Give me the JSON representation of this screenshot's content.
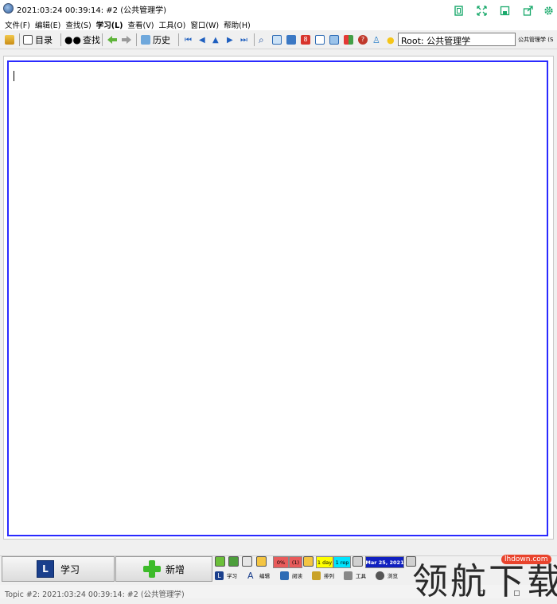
{
  "window": {
    "title": "2021:03:24 00:39:14: #2 (公共管理学)"
  },
  "menu": [
    "文件(F)",
    "编辑(E)",
    "查找(S)",
    "学习(L)",
    "查看(V)",
    "工具(O)",
    "窗口(W)",
    "帮助(H)"
  ],
  "toolbar": {
    "contents_label": "目录",
    "find_label": "查找",
    "history_label": "历史",
    "root_path": "Root: 公共管理学",
    "root_short": "公共管理学 (S"
  },
  "bottom": {
    "learn_label": "学习",
    "learn_badge": "L",
    "add_label": "新增",
    "stat_percent": "0%",
    "stat_count": "(1)",
    "stat_day": "1 day",
    "stat_rep": "1 rep",
    "stat_date": "Mar 25, 2021",
    "tools": [
      "学习",
      "编辑",
      "阅读",
      "排列",
      "工具",
      "浏览"
    ],
    "tools_badge": "L",
    "edit_letter": "A"
  },
  "status": {
    "text": "Topic #2: 2021:03:24 00:39:14: #2 (公共管理学)"
  },
  "watermark": {
    "url": "lhdown.com",
    "big_text": "领航下载"
  },
  "colors": {
    "editor_border": "#2a2aff",
    "accent_green": "#19a96b",
    "stat_red": "#e85b5b",
    "stat_yellow": "#ffff00",
    "stat_cyan": "#00e5ff",
    "stat_blue": "#1020c0"
  }
}
